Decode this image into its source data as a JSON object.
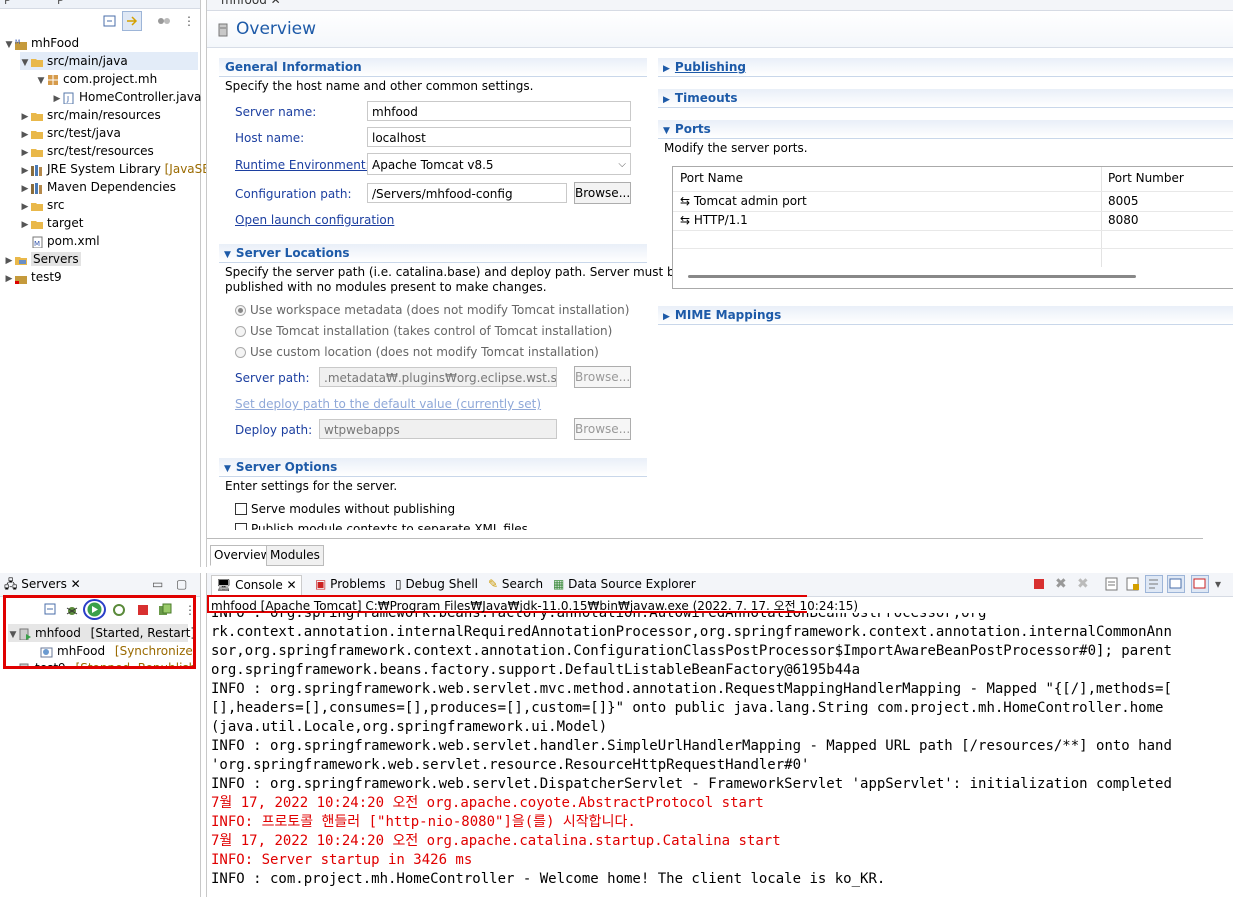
{
  "project_explorer": {
    "tabs": [
      "P",
      "P"
    ],
    "items": [
      {
        "label": "mhFood",
        "deco": ""
      },
      {
        "label": "src/main/java",
        "deco": ""
      },
      {
        "label": "com.project.mh",
        "deco": ""
      },
      {
        "label": "HomeController.java",
        "deco": ""
      },
      {
        "label": "src/main/resources",
        "deco": ""
      },
      {
        "label": "src/test/java",
        "deco": ""
      },
      {
        "label": "src/test/resources",
        "deco": ""
      },
      {
        "label": "JRE System Library",
        "deco": "[JavaSE"
      },
      {
        "label": "Maven Dependencies",
        "deco": ""
      },
      {
        "label": "src",
        "deco": ""
      },
      {
        "label": "target",
        "deco": ""
      },
      {
        "label": "pom.xml",
        "deco": ""
      },
      {
        "label": "Servers",
        "deco": ""
      },
      {
        "label": "test9",
        "deco": ""
      }
    ]
  },
  "editor": {
    "tab": "mhfood",
    "title": "Overview",
    "general": {
      "heading": "General Information",
      "desc": "Specify the host name and other common settings.",
      "server_name_label": "Server name:",
      "server_name": "mhfood",
      "host_name_label": "Host name:",
      "host_name": "localhost",
      "runtime_label": "Runtime Environment:",
      "runtime": "Apache Tomcat v8.5",
      "config_label": "Configuration path:",
      "config_path": "/Servers/mhfood-config",
      "browse": "Browse...",
      "open_launch": "Open launch configuration"
    },
    "locations": {
      "heading": "Server Locations",
      "desc1": "Specify the server path (i.e. catalina.base) and deploy path. Server must be",
      "desc2": "published with no modules present to make changes.",
      "opt1": "Use workspace metadata (does not modify Tomcat installation)",
      "opt2": "Use Tomcat installation (takes control of Tomcat installation)",
      "opt3": "Use custom location (does not modify Tomcat installation)",
      "server_path_label": "Server path:",
      "server_path": ".metadata₩.plugins₩org.eclipse.wst.server.c",
      "set_default": "Set deploy path to the default value (currently set)",
      "deploy_label": "Deploy path:",
      "deploy_path": "wtpwebapps",
      "browse": "Browse..."
    },
    "options": {
      "heading": "Server Options",
      "desc": "Enter settings for the server.",
      "opt1": "Serve modules without publishing",
      "opt2": "Publish module contexts to separate XML files"
    },
    "publishing": "Publishing",
    "timeouts": "Timeouts",
    "ports": {
      "heading": "Ports",
      "desc": "Modify the server ports.",
      "col1": "Port Name",
      "col2": "Port Number",
      "rows": [
        {
          "name": "Tomcat admin port",
          "number": "8005"
        },
        {
          "name": "HTTP/1.1",
          "number": "8080"
        }
      ]
    },
    "mime": "MIME Mappings",
    "bottom_tabs": [
      "Overview",
      "Modules"
    ]
  },
  "servers_view": {
    "tab": "Servers",
    "servers": [
      {
        "name": "mhfood",
        "state": "[Started, Restart]"
      },
      {
        "name": "mhFood",
        "state": "[Synchronized]"
      },
      {
        "name": "test9",
        "state": "[Stopped, Republish]"
      }
    ]
  },
  "console": {
    "tabs": [
      "Console",
      "Problems",
      "Debug Shell",
      "Search",
      "Data Source Explorer"
    ],
    "header": "mhfood [Apache Tomcat] C:₩Program Files₩Java₩jdk-11.0.15₩bin₩javaw.exe  (2022. 7. 17. 오전 10:24:15)",
    "lines": [
      {
        "text": "rk.context.annotation.internalRequiredAnnotationProcessor,org.springframework.context.annotation.internalCommonAnn",
        "red": false
      },
      {
        "text": "sor,org.springframework.context.annotation.ConfigurationClassPostProcessor$ImportAwareBeanPostProcessor#0]; parent",
        "red": false
      },
      {
        "text": "org.springframework.beans.factory.support.DefaultListableBeanFactory@6195b44a",
        "red": false
      },
      {
        "text": "INFO : org.springframework.web.servlet.mvc.method.annotation.RequestMappingHandlerMapping - Mapped \"{[/],methods=[",
        "red": false
      },
      {
        "text": "[],headers=[],consumes=[],produces=[],custom=[]}\" onto public java.lang.String com.project.mh.HomeController.home",
        "red": false
      },
      {
        "text": "(java.util.Locale,org.springframework.ui.Model)",
        "red": false
      },
      {
        "text": "INFO : org.springframework.web.servlet.handler.SimpleUrlHandlerMapping - Mapped URL path [/resources/**] onto hand",
        "red": false
      },
      {
        "text": "'org.springframework.web.servlet.resource.ResourceHttpRequestHandler#0'",
        "red": false
      },
      {
        "text": "INFO : org.springframework.web.servlet.DispatcherServlet - FrameworkServlet 'appServlet': initialization completed",
        "red": false
      },
      {
        "text": "7월 17, 2022 10:24:20 오전 org.apache.coyote.AbstractProtocol start",
        "red": true
      },
      {
        "text": "INFO: 프로토콜 핸들러 [\"http-nio-8080\"]을(를) 시작합니다.",
        "red": true
      },
      {
        "text": "7월 17, 2022 10:24:20 오전 org.apache.catalina.startup.Catalina start",
        "red": true
      },
      {
        "text": "INFO: Server startup in 3426 ms",
        "red": true
      },
      {
        "text": "INFO : com.project.mh.HomeController - Welcome home! The client locale is ko_KR.",
        "red": false
      }
    ]
  },
  "colors": {
    "accent": "#1d5aa8",
    "error": "#e00000",
    "highlight_box": "#e00000",
    "circle": "#2a3fc8"
  }
}
